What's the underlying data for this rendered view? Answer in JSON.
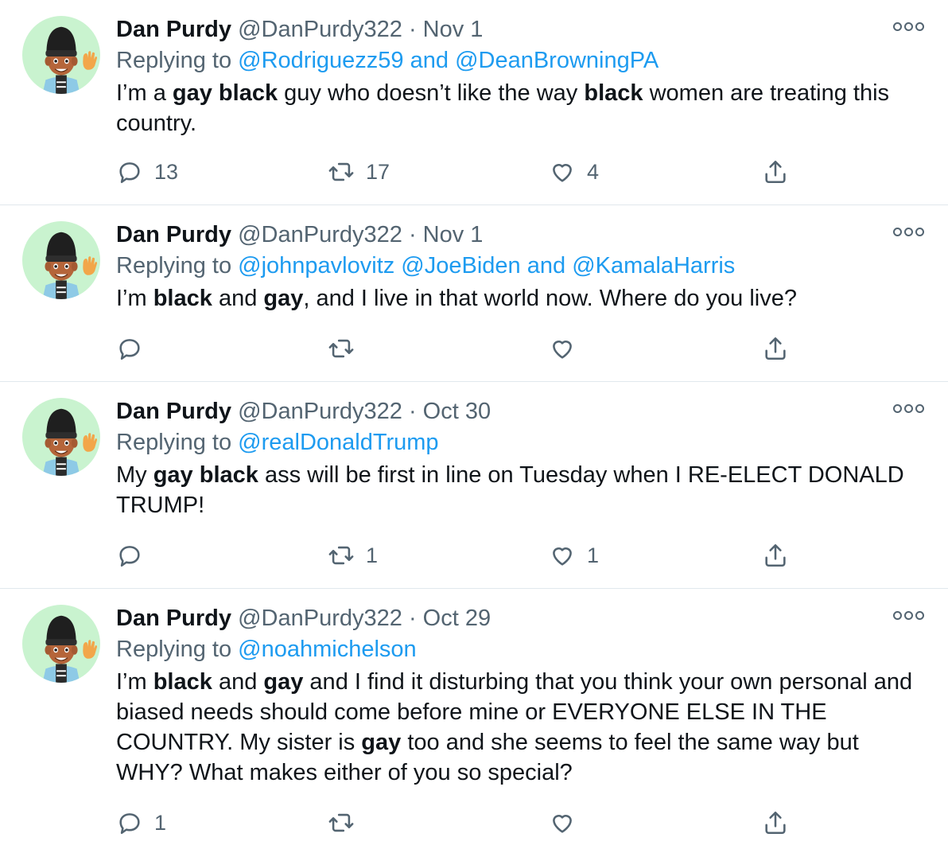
{
  "tweets": [
    {
      "name": "Dan Purdy",
      "handle": "@DanPurdy322",
      "dot": "·",
      "date": "Nov 1",
      "replying_label": "Replying to",
      "mentions_a": "@Rodriguezz59",
      "joiner_a": "and",
      "mentions_b": "@DeanBrowningPA",
      "text": [
        {
          "t": "I’m a ",
          "b": false
        },
        {
          "t": "gay black",
          "b": true
        },
        {
          "t": " guy who doesn’t like the way ",
          "b": false
        },
        {
          "t": "black",
          "b": true
        },
        {
          "t": " women are treating this country.",
          "b": false
        }
      ],
      "replies": "13",
      "retweets": "17",
      "likes": "4"
    },
    {
      "name": "Dan Purdy",
      "handle": "@DanPurdy322",
      "dot": "·",
      "date": "Nov 1",
      "replying_label": "Replying to",
      "mentions_a": "@johnpavlovitz @JoeBiden",
      "joiner_a": "and",
      "mentions_b": "@KamalaHarris",
      "text": [
        {
          "t": "I’m ",
          "b": false
        },
        {
          "t": "black",
          "b": true
        },
        {
          "t": " and ",
          "b": false
        },
        {
          "t": "gay",
          "b": true
        },
        {
          "t": ", and I live in that world now. Where do you live?",
          "b": false
        }
      ],
      "replies": "",
      "retweets": "",
      "likes": ""
    },
    {
      "name": "Dan Purdy",
      "handle": "@DanPurdy322",
      "dot": "·",
      "date": "Oct 30",
      "replying_label": "Replying to",
      "mentions_a": "@realDonaldTrump",
      "joiner_a": "",
      "mentions_b": "",
      "text": [
        {
          "t": "My ",
          "b": false
        },
        {
          "t": "gay black",
          "b": true
        },
        {
          "t": " ass will be first in line on Tuesday when I RE-ELECT DONALD TRUMP!",
          "b": false
        }
      ],
      "replies": "",
      "retweets": "1",
      "likes": "1"
    },
    {
      "name": "Dan Purdy",
      "handle": "@DanPurdy322",
      "dot": "·",
      "date": "Oct 29",
      "replying_label": "Replying to",
      "mentions_a": "@noahmichelson",
      "joiner_a": "",
      "mentions_b": "",
      "text": [
        {
          "t": "I’m ",
          "b": false
        },
        {
          "t": "black",
          "b": true
        },
        {
          "t": " and ",
          "b": false
        },
        {
          "t": "gay",
          "b": true
        },
        {
          "t": " and I find it disturbing that you think your own personal and biased needs should come before mine or EVERYONE ELSE IN THE COUNTRY. My sister is ",
          "b": false
        },
        {
          "t": "gay",
          "b": true
        },
        {
          "t": " too and she seems to feel the same way but WHY? What makes either of you so special?",
          "b": false
        }
      ],
      "replies": "1",
      "retweets": "",
      "likes": ""
    }
  ],
  "colors": {
    "text": "#0f1419",
    "muted": "#536471",
    "link": "#1d9bf0",
    "avatar_bg": "#c9f3cf"
  }
}
